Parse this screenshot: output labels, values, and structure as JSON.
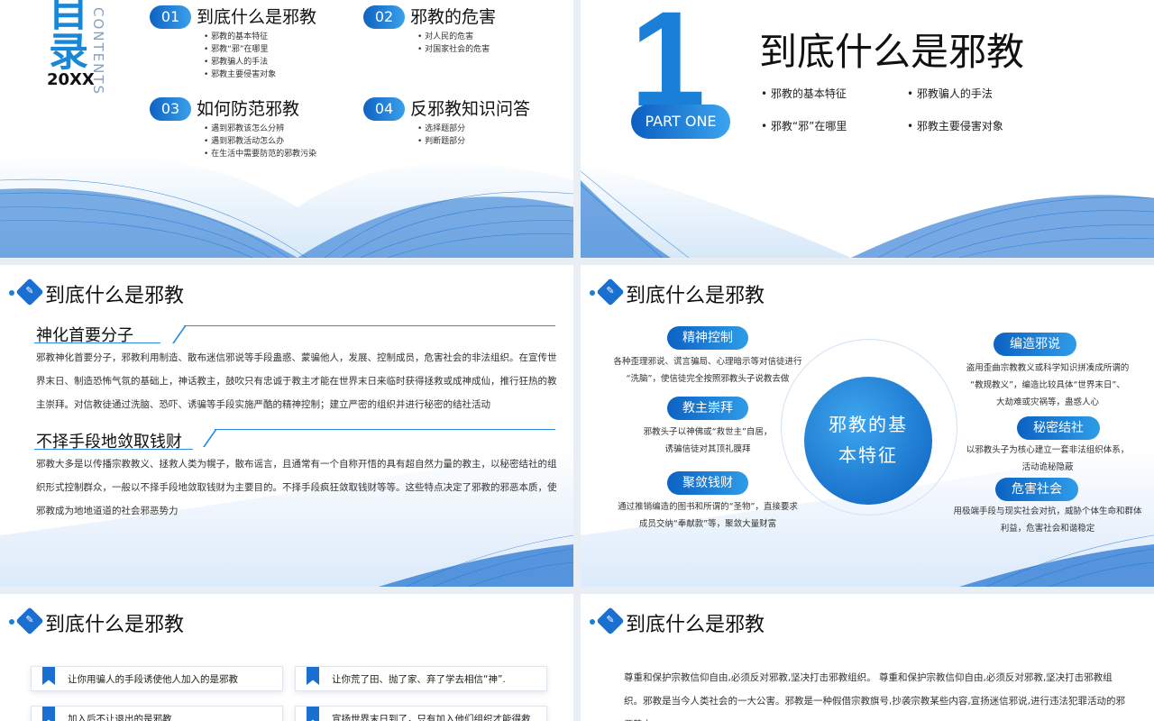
{
  "slide1": {
    "big_text": "目录",
    "year": "20XX",
    "contents_label": "CONTENTS",
    "items": [
      {
        "num": "01",
        "title": "到底什么是邪教",
        "subs": [
          "邪教的基本特征",
          "邪教“邪”在哪里",
          "邪教骗人的手法",
          "邪教主要侵害对象"
        ]
      },
      {
        "num": "02",
        "title": "邪教的危害",
        "subs": [
          "对人民的危害",
          "对国家社会的危害"
        ]
      },
      {
        "num": "03",
        "title": "如何防范邪教",
        "subs": [
          "遇到邪教该怎么分辨",
          "遇到邪教活动怎么办",
          "在生活中需要防范的邪教污染"
        ]
      },
      {
        "num": "04",
        "title": "反邪教知识问答",
        "subs": [
          "选择题部分",
          "判断题部分"
        ]
      }
    ]
  },
  "slide2": {
    "big_number": "1",
    "part_label": "PART ONE",
    "title": "到底什么是邪教",
    "points": [
      "邪教的基本特征",
      "邪教骗人的手法",
      "邪教“邪”在哪里",
      "邪教主要侵害对象"
    ]
  },
  "slide3": {
    "header": "到底什么是邪教",
    "sections": [
      {
        "title": "神化首要分子",
        "text": "邪教神化首要分子，邪教利用制造、散布迷信邪说等手段蛊惑、蒙骗他人，发展、控制成员，危害社会的非法组织。在宣传世界末日、制造恐怖气氛的基础上，神话教主，鼓吹只有忠诚于教主才能在世界末日来临时获得拯救或成神成仙，推行狂热的教主崇拜。对信教徒通过洗脑、恐吓、诱骗等手段实施严酷的精神控制；建立严密的组织并进行秘密的结社活动"
      },
      {
        "title": "不择手段地敛取钱财",
        "text": "邪教大多是以传播宗教教义、拯救人类为幌子，散布谣言，且通常有一个自称开悟的具有超自然力量的教主，以秘密结社的组织形式控制群众，一般以不择手段地敛取钱财为主要目的。不择手段疯狂敛取钱财等等。这些特点决定了邪教的邪恶本质，使邪教成为地地道道的社会邪恶势力"
      }
    ]
  },
  "slide4": {
    "header": "到底什么是邪教",
    "center": "邪教的基本特征",
    "center_line1": "邪教的基",
    "center_line2": "本特征",
    "left": [
      {
        "tag": "精神控制",
        "desc1": "各种歪理邪说、谎言骗局、心理暗示等对信徒进行",
        "desc2": "“洗脑”，使信徒完全按照邪教头子说教去做"
      },
      {
        "tag": "教主崇拜",
        "desc1": "邪教头子以神佛或“救世主”自居，",
        "desc2": "诱骗信徒对其顶礼膜拜"
      },
      {
        "tag": "聚敛钱财",
        "desc1": "通过推销编造的图书和所谓的“圣物”，直接要求",
        "desc2": "成员交纳“奉献款”等，聚敛大量财富"
      }
    ],
    "right": [
      {
        "tag": "编造邪说",
        "desc1": "盗用歪曲宗教教义或科学知识拼凑成所谓的",
        "desc2": "“教规教义”，编造比较具体“世界末日”、",
        "desc3": "大劫难或灾祸等，蛊惑人心"
      },
      {
        "tag": "秘密结社",
        "desc1": "以邪教头子为核心建立一套非法组织体系，",
        "desc2": "活动诡秘隐蔽"
      },
      {
        "tag": "危害社会",
        "desc1": "用极端手段与现实社会对抗，威胁个体生命和群体",
        "desc2": "利益，危害社会和谐稳定"
      }
    ]
  },
  "slide5": {
    "header": "到底什么是邪教",
    "cards": [
      "让你用骗人的手段诱使他人加入的是邪教",
      "让你荒了田、抛了家、弃了学去相信“神”.",
      "加入后不让退出的是邪教",
      "宣扬世界末日到了，只有加入他们组织才能得救"
    ]
  },
  "slide6": {
    "header": "到底什么是邪教",
    "text": "尊重和保护宗教信仰自由,必须反对邪教,坚决打击邪教组织。 尊重和保护宗教信仰自由,必须反对邪教,坚决打击邪教组织。邪教是当今人类社会的一大公害。邪教是一种假借宗教旗号,抄袭宗教某些内容,宣扬迷信邪说,进行违法犯罪活动的邪恶势力"
  },
  "colors": {
    "accent": "#1a7fd6",
    "accent_dark": "#0c5fc0"
  }
}
